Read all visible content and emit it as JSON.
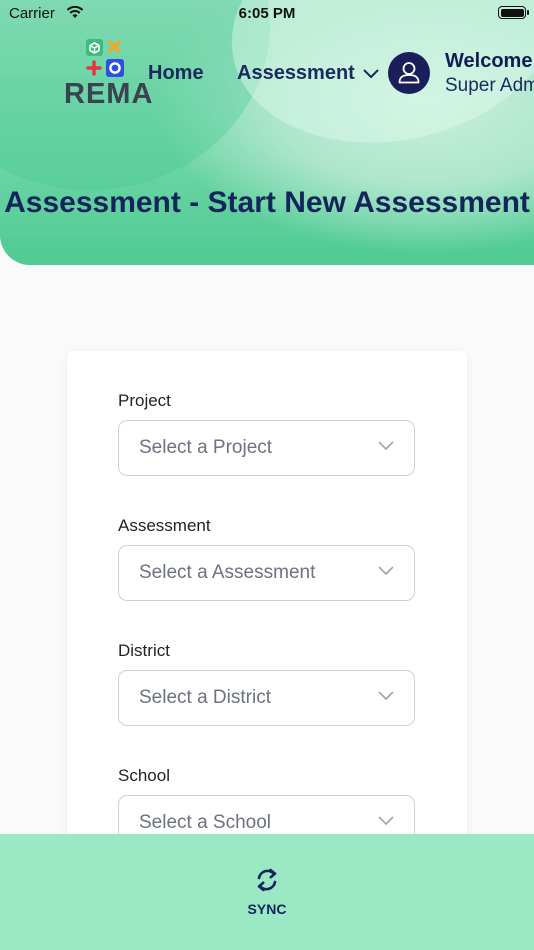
{
  "status_bar": {
    "carrier": "Carrier",
    "time": "6:05 PM"
  },
  "header": {
    "logo_text": "REMA",
    "nav": {
      "home": "Home",
      "assessment": "Assessment"
    },
    "user": {
      "welcome": "Welcome,",
      "role": "Super Admin"
    },
    "page_title": "Assessment - Start New Assessment"
  },
  "form": {
    "fields": [
      {
        "label": "Project",
        "placeholder": "Select a Project"
      },
      {
        "label": "Assessment",
        "placeholder": "Select a Assessment"
      },
      {
        "label": "District",
        "placeholder": "Select a District"
      },
      {
        "label": "School",
        "placeholder": "Select a School"
      }
    ]
  },
  "bottom_bar": {
    "sync_label": "SYNC"
  },
  "colors": {
    "header_green": "#78d8ad",
    "navy": "#1b2a5e",
    "bottom_bar": "#9be9c4",
    "logo_cube": "#3dbd7d",
    "logo_x": "#f5a623",
    "logo_plus": "#e8323c",
    "logo_o": "#2f4fe0"
  }
}
